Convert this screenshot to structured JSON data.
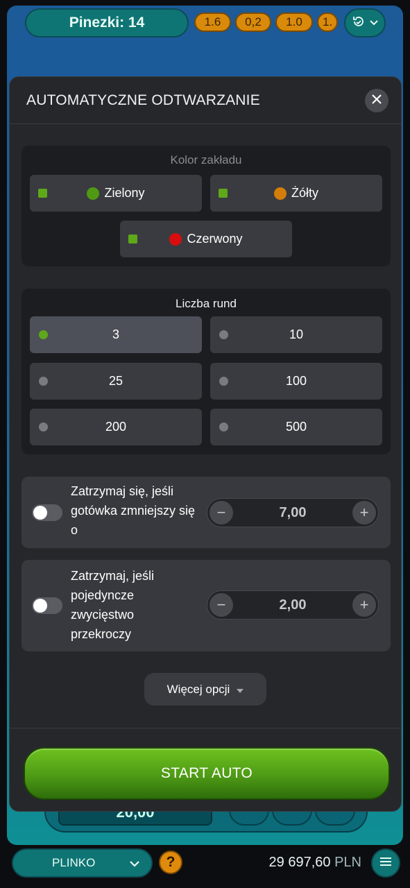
{
  "topbar": {
    "pins_label": "Pinezki: 14",
    "multipliers": [
      "1.6",
      "0,2",
      "1.0",
      "1."
    ],
    "history_icon": "history-clock-icon"
  },
  "background": {
    "bet_value": "20,00"
  },
  "modal": {
    "title": "AUTOMATYCZNE ODTWARZANIE",
    "bet_color": {
      "title": "Kolor zakładu",
      "options": [
        {
          "label": "Zielony",
          "color": "#4f9a12",
          "checked": true
        },
        {
          "label": "Żółty",
          "color": "#d57d0a",
          "checked": true
        },
        {
          "label": "Czerwony",
          "color": "#d90d0d",
          "checked": true
        }
      ]
    },
    "rounds": {
      "title": "Liczba rund",
      "options": [
        "3",
        "10",
        "25",
        "100",
        "200",
        "500"
      ],
      "selected": "3"
    },
    "stop_cash": {
      "label_lines": [
        "Zatrzymaj się, jeśli",
        "gotówka zmniejszy się",
        "o"
      ],
      "value": "7,00",
      "enabled": false
    },
    "stop_win": {
      "label_lines": [
        "Zatrzymaj, jeśli",
        "pojedyncze",
        "zwycięstwo",
        "przekroczy"
      ],
      "value": "2,00",
      "enabled": false
    },
    "more_options": "Więcej opcji",
    "start_label": "START AUTO"
  },
  "bottombar": {
    "game": "PLINKO",
    "help": "?",
    "balance": "29 697,60",
    "currency": "PLN"
  },
  "colors": {
    "accent_green": "#5ea819",
    "panel": "#26272b",
    "teal": "#0f7574",
    "orange": "#d98a0a"
  }
}
